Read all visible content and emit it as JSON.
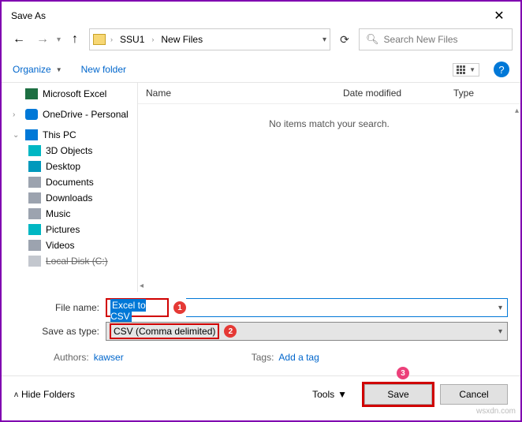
{
  "window": {
    "title": "Save As"
  },
  "nav": {
    "path_segments": [
      "SSU1",
      "New Files"
    ],
    "refresh_tooltip": "Refresh"
  },
  "search": {
    "placeholder": "Search New Files"
  },
  "toolbar": {
    "organize_label": "Organize",
    "newfolder_label": "New folder"
  },
  "sidebar": {
    "items": [
      {
        "label": "Microsoft Excel",
        "icon": "excel"
      },
      {
        "label": "OneDrive - Personal",
        "icon": "onedrive"
      },
      {
        "label": "This PC",
        "icon": "pc",
        "expanded": true
      },
      {
        "label": "3D Objects",
        "icon": "3d"
      },
      {
        "label": "Desktop",
        "icon": "desk"
      },
      {
        "label": "Documents",
        "icon": "doc"
      },
      {
        "label": "Downloads",
        "icon": "down"
      },
      {
        "label": "Music",
        "icon": "mus"
      },
      {
        "label": "Pictures",
        "icon": "pic"
      },
      {
        "label": "Videos",
        "icon": "vid"
      },
      {
        "label": "Local Disk (C:)",
        "icon": "disk"
      }
    ]
  },
  "columns": {
    "name": "Name",
    "date": "Date modified",
    "type": "Type"
  },
  "empty_msg": "No items match your search.",
  "filename": {
    "label": "File name:",
    "value": "Excel to CSV"
  },
  "savetype": {
    "label": "Save as type:",
    "value": "CSV (Comma delimited)"
  },
  "authors": {
    "label": "Authors:",
    "value": "kawser"
  },
  "tags": {
    "label": "Tags:",
    "value": "Add a tag"
  },
  "footer": {
    "hide_label": "Hide Folders",
    "tools_label": "Tools",
    "save_label": "Save",
    "cancel_label": "Cancel"
  },
  "badges": {
    "b1": "1",
    "b2": "2",
    "b3": "3"
  },
  "watermark": "wsxdn.com"
}
